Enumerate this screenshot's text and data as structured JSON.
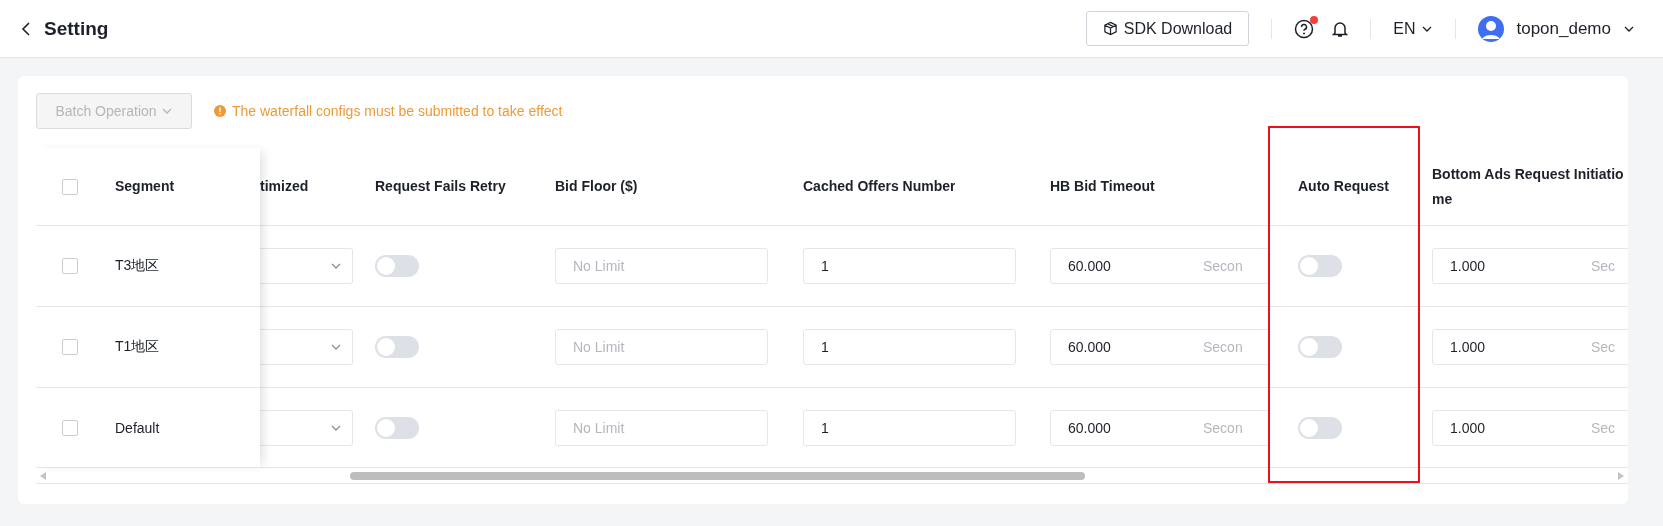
{
  "header": {
    "title": "Setting",
    "sdk_button": "SDK Download",
    "help_notification": true,
    "language": "EN",
    "user": "topon_demo"
  },
  "toolbar": {
    "batch_button": {
      "label": "Batch Operation",
      "disabled": true
    },
    "notice": "The waterfall configs must be submitted to take effect"
  },
  "table": {
    "select_all": {
      "checked": false
    },
    "segment_header": "Segment",
    "columns": [
      {
        "title": [
          "timized"
        ],
        "highlighted": false
      },
      {
        "title": [
          "Request Fails Retry"
        ],
        "highlighted": false
      },
      {
        "title": [
          "Bid Floor ($)"
        ],
        "highlighted": false
      },
      {
        "title": [
          "Cached Offers Number"
        ],
        "highlighted": false
      },
      {
        "title": [
          "HB Bid Timeout"
        ],
        "highlighted": false
      },
      {
        "title": [
          "Auto Request"
        ],
        "highlighted": true
      },
      {
        "title": [
          "Bottom Ads Request Initiatio",
          "me"
        ],
        "highlighted": false
      }
    ],
    "rows": [
      {
        "segment": "T3地区",
        "checked": false,
        "cells": [
          {
            "kind": "select"
          },
          {
            "kind": "toggle",
            "on": false
          },
          {
            "kind": "input",
            "placeholder": "No Limit"
          },
          {
            "kind": "input",
            "value": "1"
          },
          {
            "kind": "input",
            "value": "60.000",
            "suffix": "Secon"
          },
          {
            "kind": "toggle",
            "on": false
          },
          {
            "kind": "input",
            "value": "1.000",
            "suffix": "Sec"
          }
        ]
      },
      {
        "segment": "T1地区",
        "checked": false,
        "cells": [
          {
            "kind": "select"
          },
          {
            "kind": "toggle",
            "on": false
          },
          {
            "kind": "input",
            "placeholder": "No Limit"
          },
          {
            "kind": "input",
            "value": "1"
          },
          {
            "kind": "input",
            "value": "60.000",
            "suffix": "Secon"
          },
          {
            "kind": "toggle",
            "on": false
          },
          {
            "kind": "input",
            "value": "1.000",
            "suffix": "Sec"
          }
        ]
      },
      {
        "segment": "Default",
        "checked": false,
        "cells": [
          {
            "kind": "select"
          },
          {
            "kind": "toggle",
            "on": false
          },
          {
            "kind": "input",
            "placeholder": "No Limit"
          },
          {
            "kind": "input",
            "value": "1"
          },
          {
            "kind": "input",
            "value": "60.000",
            "suffix": "Secon"
          },
          {
            "kind": "toggle",
            "on": false
          },
          {
            "kind": "input",
            "value": "1.000",
            "suffix": "Sec"
          }
        ]
      }
    ]
  }
}
